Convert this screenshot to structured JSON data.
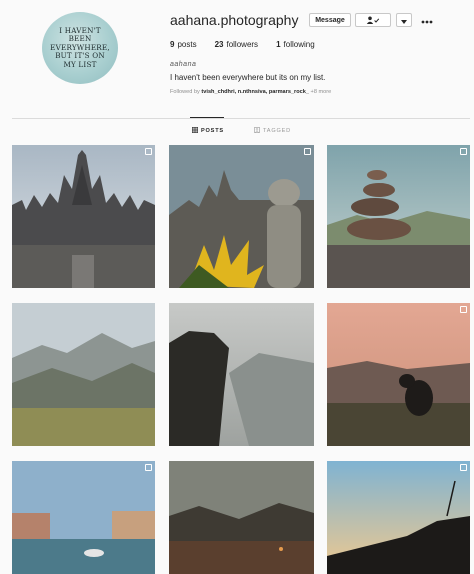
{
  "profile": {
    "username": "aahana.photography",
    "avatar_text": "I haven't been everywhere, but it's on my list",
    "message_label": "Message",
    "stats": {
      "posts_count": "9",
      "posts_label": "posts",
      "followers_count": "23",
      "followers_label": "followers",
      "following_count": "1",
      "following_label": "following"
    },
    "full_name": "aahana",
    "bio": "I haven't been everywhere but its on my list.",
    "followed_by_prefix": "Followed by",
    "followed_by_names": "tvish_chdhri, n.nthnsiva, parmars_rock_",
    "followed_by_more": "+8 more"
  },
  "tabs": {
    "posts": "POSTS",
    "tagged": "TAGGED"
  },
  "icons": {
    "following": "person-check-icon",
    "dropdown": "chevron-down-icon",
    "more": "more-options-icon",
    "posts": "grid-icon",
    "tagged": "tag-icon",
    "multi": "multiple-photos-icon"
  }
}
